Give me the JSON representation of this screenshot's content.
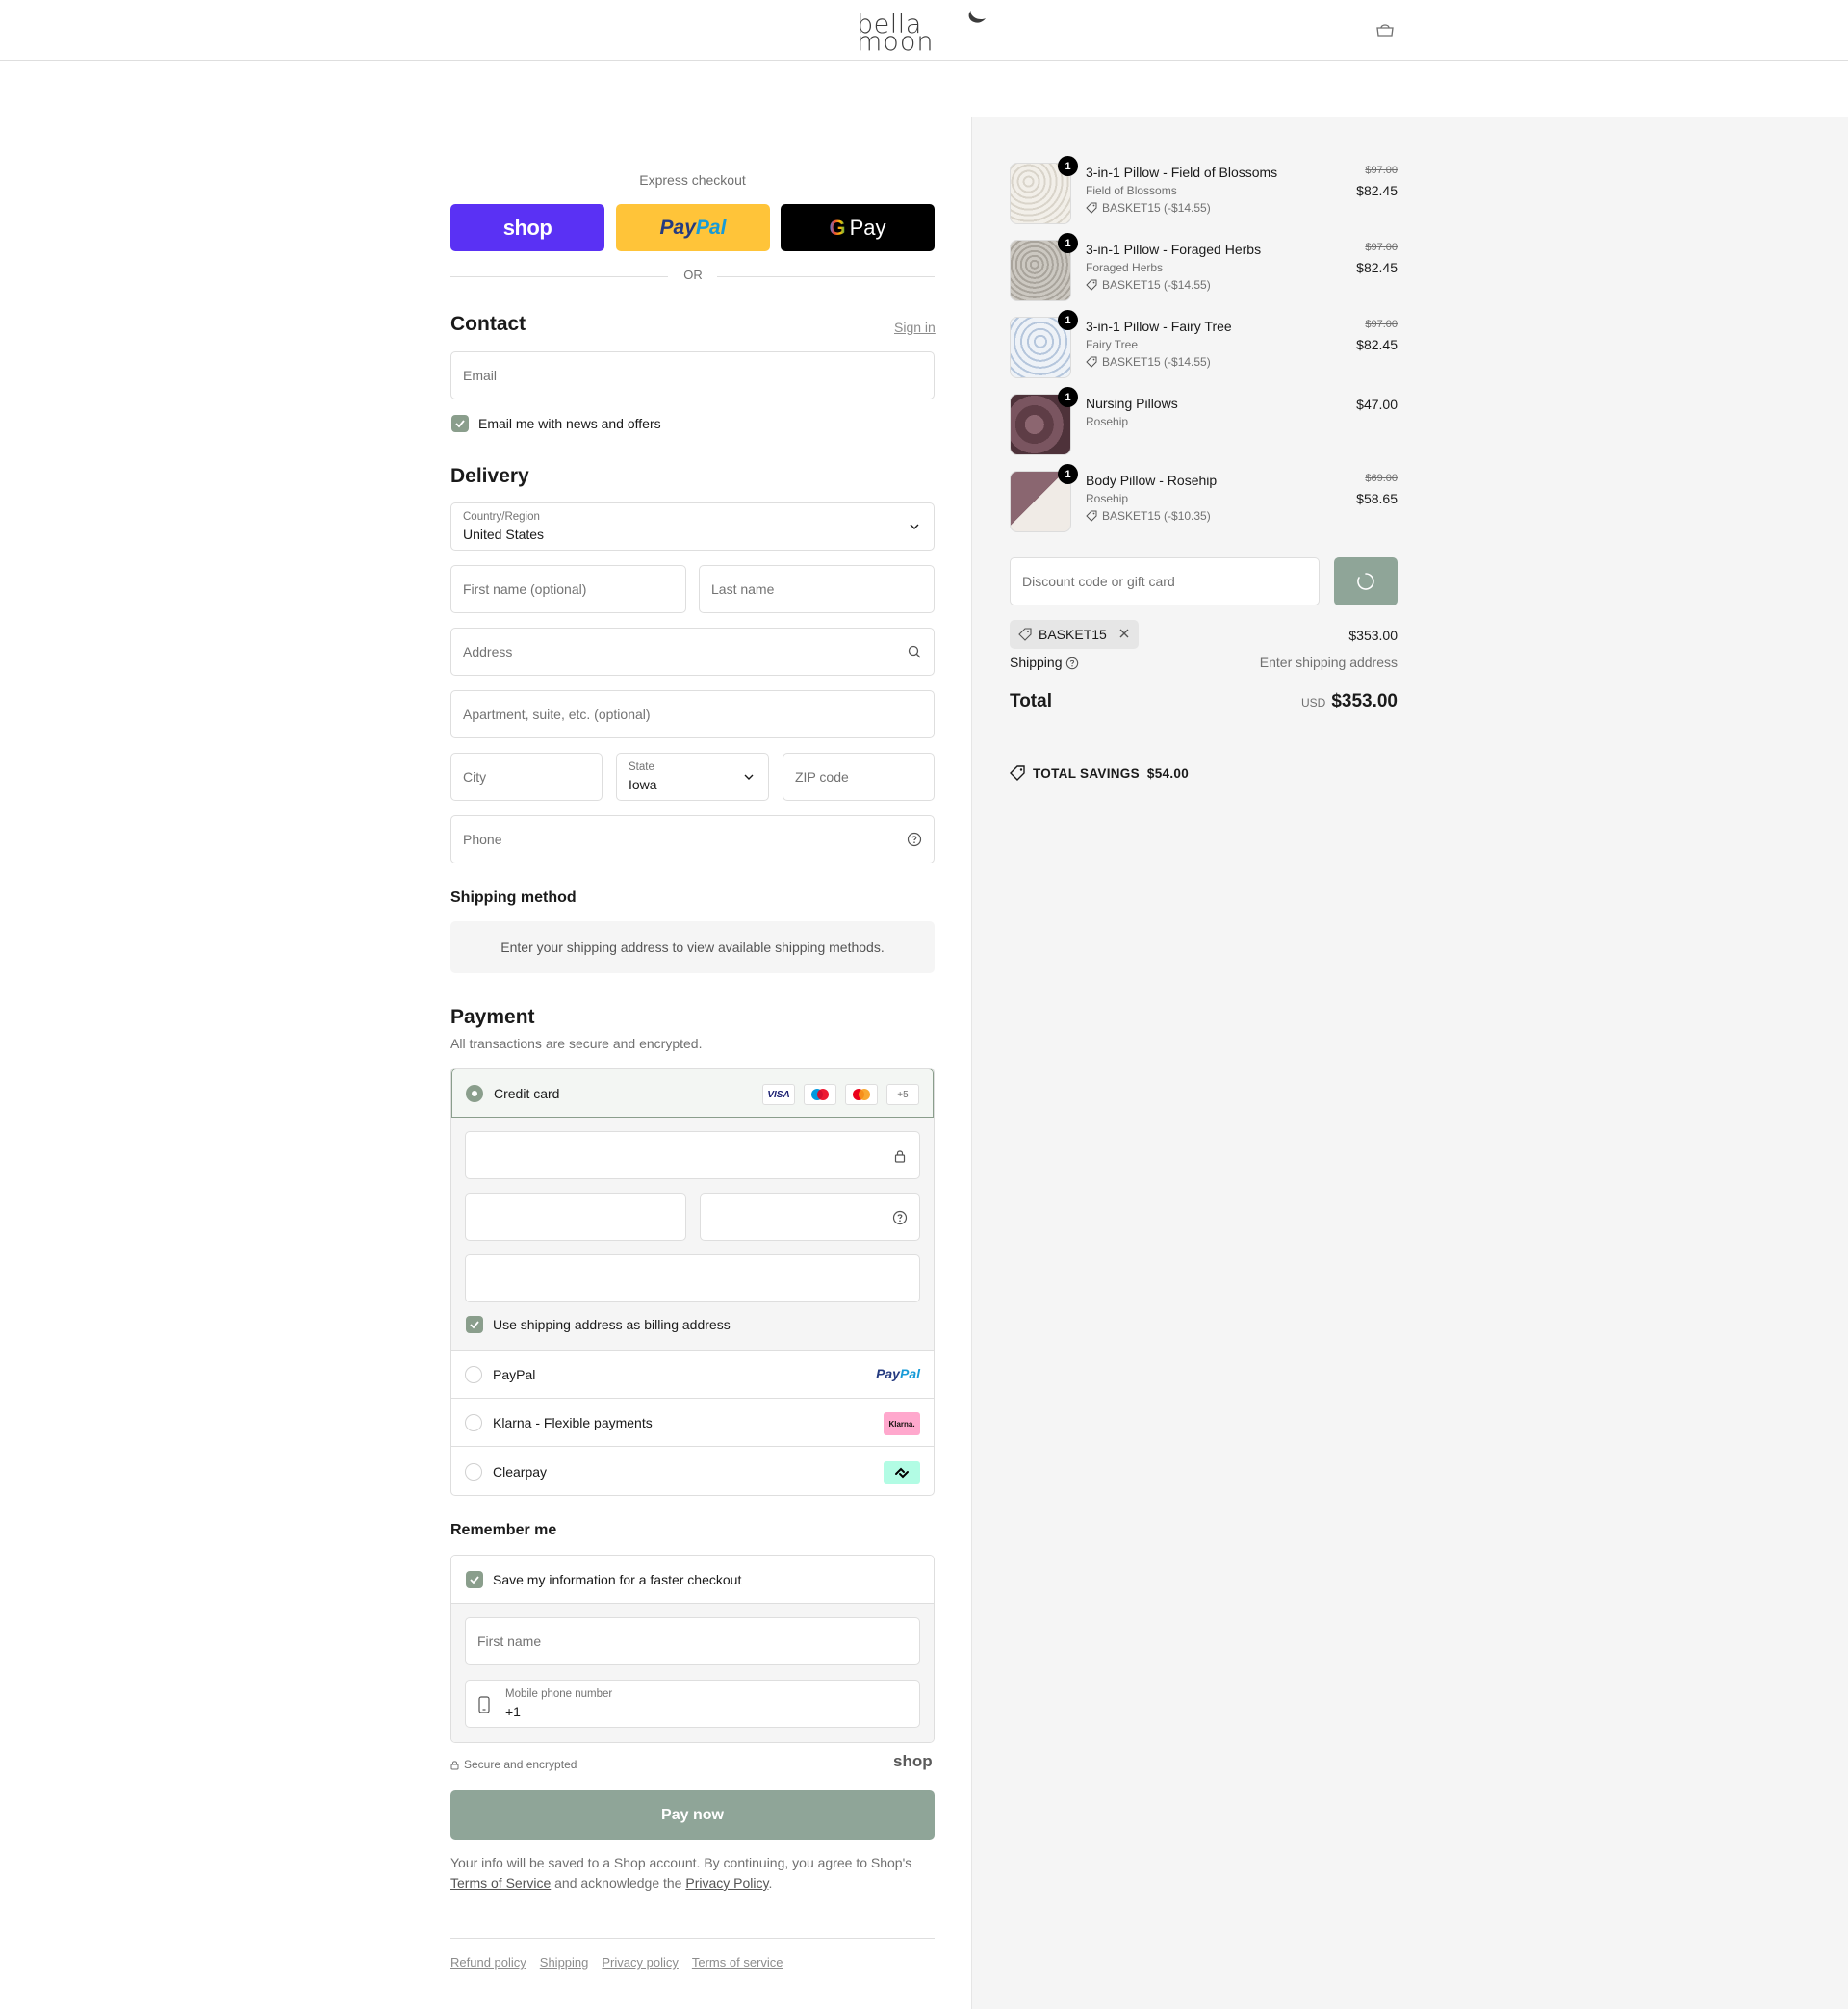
{
  "header": {
    "logo_line1": "bella",
    "logo_line2": "moon"
  },
  "express": {
    "title": "Express checkout",
    "shop_label": "shop",
    "paypal_a": "Pay",
    "paypal_b": "Pal",
    "gpay_g": "G",
    "gpay_label": "Pay",
    "or": "OR"
  },
  "contact": {
    "title": "Contact",
    "sign_in": "Sign in",
    "email_placeholder": "Email",
    "news_label": "Email me with news and offers"
  },
  "delivery": {
    "title": "Delivery",
    "country_label": "Country/Region",
    "country_value": "United States",
    "first_name": "First name (optional)",
    "last_name": "Last name",
    "address": "Address",
    "apartment": "Apartment, suite, etc. (optional)",
    "city": "City",
    "state_label": "State",
    "state_value": "Iowa",
    "zip": "ZIP code",
    "phone": "Phone"
  },
  "shipping_method": {
    "title": "Shipping method",
    "info": "Enter your shipping address to view available shipping methods."
  },
  "payment": {
    "title": "Payment",
    "subtitle": "All transactions are secure and encrypted.",
    "credit_card": "Credit card",
    "card_visa": "VISA",
    "card_more": "+5",
    "billing_label": "Use shipping address as billing address",
    "paypal": "PayPal",
    "paypal_logo_a": "Pay",
    "paypal_logo_b": "Pal",
    "klarna": "Klarna - Flexible payments",
    "klarna_logo": "Klarna.",
    "clearpay": "Clearpay"
  },
  "remember": {
    "title": "Remember me",
    "save_label": "Save my information for a faster checkout",
    "first_name": "First name",
    "phone_label": "Mobile phone number",
    "phone_value": "+1",
    "secure": "Secure and encrypted",
    "shop": "shop"
  },
  "pay_now": "Pay now",
  "legal": {
    "text1": "Your info will be saved to a Shop account. By continuing, you agree to Shop's",
    "terms": "Terms of Service",
    "text2": "and acknowledge the",
    "privacy": "Privacy Policy",
    "text3": "."
  },
  "footer": {
    "links": [
      "Refund policy",
      "Shipping",
      "Privacy policy",
      "Terms of service"
    ]
  },
  "cart": {
    "items": [
      {
        "name": "3-in-1 Pillow - Field of Blossoms",
        "variant": "Field of Blossoms",
        "discount": "BASKET15 (-$14.55)",
        "old_price": "$97.00",
        "price": "$82.45",
        "qty": "1"
      },
      {
        "name": "3-in-1 Pillow - Foraged Herbs",
        "variant": "Foraged Herbs",
        "discount": "BASKET15 (-$14.55)",
        "old_price": "$97.00",
        "price": "$82.45",
        "qty": "1"
      },
      {
        "name": "3-in-1 Pillow - Fairy Tree",
        "variant": "Fairy Tree",
        "discount": "BASKET15 (-$14.55)",
        "old_price": "$97.00",
        "price": "$82.45",
        "qty": "1"
      },
      {
        "name": "Nursing Pillows",
        "variant": "Rosehip",
        "price": "$47.00",
        "qty": "1"
      },
      {
        "name": "Body Pillow - Rosehip",
        "variant": "Rosehip",
        "discount": "BASKET15 (-$10.35)",
        "old_price": "$69.00",
        "price": "$58.65",
        "qty": "1"
      }
    ],
    "discount_placeholder": "Discount code or gift card",
    "applied_code": "BASKET15",
    "subtotal": "$353.00",
    "shipping_label": "Shipping",
    "shipping_value": "Enter shipping address",
    "total_label": "Total",
    "currency": "USD",
    "total": "$353.00",
    "savings_label": "TOTAL SAVINGS",
    "savings_value": "$54.00"
  },
  "colors": {
    "accent": "#8a9e8c",
    "pay_button": "#8fa598",
    "shop_purple": "#5a31f4",
    "paypal_yellow": "#ffc439"
  }
}
